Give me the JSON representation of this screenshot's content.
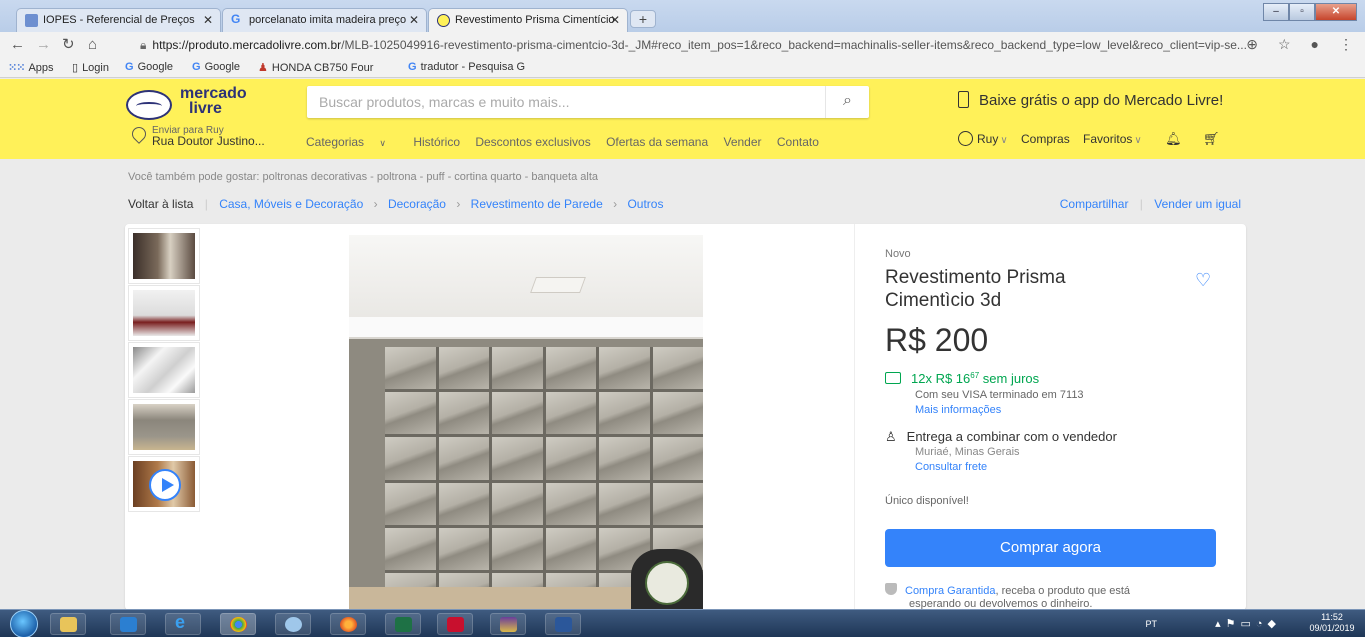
{
  "browser": {
    "tabs": [
      {
        "title": "IOPES - Referencial de Preços",
        "active": false
      },
      {
        "title": "porcelanato imita madeira preço",
        "active": false
      },
      {
        "title": "Revestimento Prisma Cimentício",
        "active": true
      }
    ],
    "url_host": "https://produto.mercadolivre.com.br",
    "url_path": "/MLB-1025049916-revestimento-prisma-cimentcio-3d-_JM#reco_item_pos=1&reco_backend=machinalis-seller-items&reco_backend_type=low_level&reco_client=vip-se...",
    "bookmarks": [
      "Apps",
      "Login",
      "Google",
      "Google",
      "HONDA CB750 Four",
      "tradutor - Pesquisa G"
    ]
  },
  "header": {
    "logo_line1": "mercado",
    "logo_line2": "livre",
    "search_placeholder": "Buscar produtos, marcas e muito mais...",
    "app_promo": "Baixe grátis o app do Mercado Livre!",
    "deliver_label": "Enviar para Ruy",
    "deliver_address": "Rua Doutor Justino...",
    "nav": [
      "Categorias",
      "Histórico",
      "Descontos exclusivos",
      "Ofertas da semana",
      "Vender",
      "Contato"
    ],
    "user": "Ruy",
    "purchases": "Compras",
    "favorites": "Favoritos"
  },
  "page": {
    "suggest": "Você também pode gostar: poltronas decorativas - poltrona - puff - cortina quarto - banqueta alta",
    "back": "Voltar à lista",
    "breadcrumbs": [
      "Casa, Móveis e Decoração",
      "Decoração",
      "Revestimento de Parede",
      "Outros"
    ],
    "share": "Compartilhar",
    "sell_same": "Vender um igual"
  },
  "product": {
    "condition": "Novo",
    "title": "Revestimento Prisma Cimentìcio 3d",
    "price": "R$ 200",
    "installments": "12x R$ 16",
    "installments_cents": "67",
    "installments_suffix": " sem juros",
    "visa": "Com seu VISA terminado em 7113",
    "more_info": "Mais informações",
    "shipping": "Entrega a combinar com o vendedor",
    "city": "Muriaé, Minas Gerais",
    "freight": "Consultar frete",
    "stock": "Único disponível!",
    "buy": "Comprar agora",
    "guarantee_link": "Compra Garantida",
    "guarantee_text": ", receba o produto que está",
    "guarantee_line2": "esperando ou devolvemos o dinheiro."
  },
  "taskbar": {
    "lang": "PT",
    "time": "11:52",
    "date": "09/01/2019"
  },
  "colors": {
    "ml_yellow": "#fff159",
    "ml_blue": "#3483fa",
    "ml_green": "#00a650"
  }
}
